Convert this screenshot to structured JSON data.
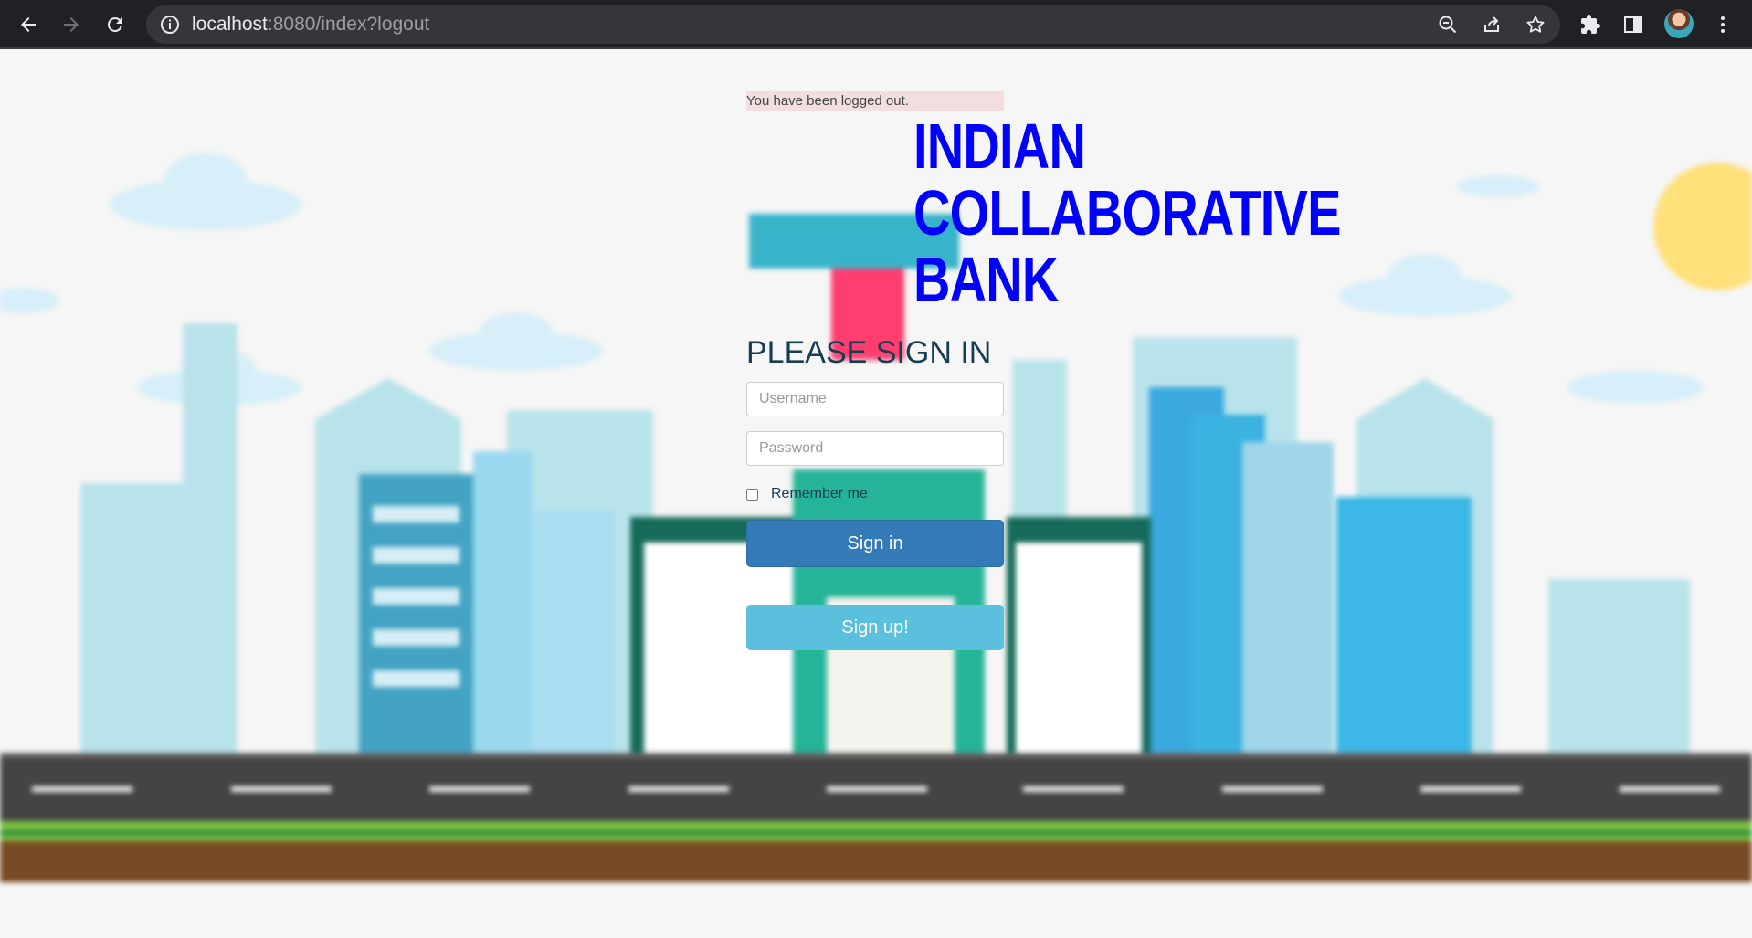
{
  "browser": {
    "url_host": "localhost",
    "url_rest": ":8080/index?logout",
    "icons": [
      "back-arrow-icon",
      "forward-arrow-icon",
      "reload-icon",
      "info-icon",
      "zoom-out-icon",
      "share-icon",
      "star-icon",
      "extensions-icon",
      "side-panel-icon",
      "profile-avatar",
      "more-vert-icon"
    ]
  },
  "alert": {
    "text": "You have been logged out."
  },
  "brand": {
    "line1": "INDIAN",
    "line2": "COLLABORATIVE",
    "line3": "BANK",
    "color": "#0000ff"
  },
  "form": {
    "heading": "PLEASE SIGN IN",
    "username_placeholder": "Username",
    "password_placeholder": "Password",
    "remember_label": "Remember me",
    "remember_checked": false,
    "signin_label": "Sign in",
    "signup_label": "Sign up!"
  },
  "colors": {
    "primary": "#337ab7",
    "info": "#5bc0de",
    "alert_bg": "#f2dede",
    "heading": "#173d52"
  }
}
